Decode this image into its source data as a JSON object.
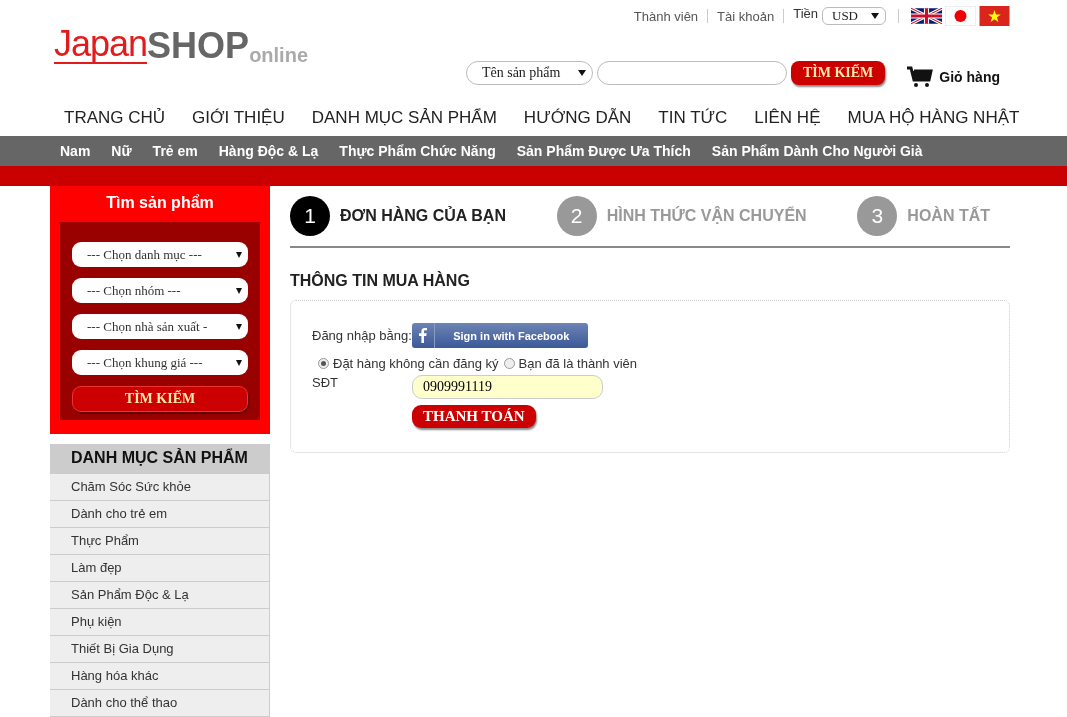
{
  "top_bar": {
    "links": [
      "Thành viên",
      "Tài khoản"
    ],
    "currency": {
      "label": "Tiền",
      "value": "USD"
    }
  },
  "logo": {
    "part_1": "Japan",
    "part_2": "SHOP",
    "part_3": "online"
  },
  "search": {
    "category": "Tên sản phẩm",
    "button": "TÌM KIẾM"
  },
  "cart": {
    "label": "Giỏ hàng"
  },
  "main_menu": [
    "TRANG CHỦ",
    "GIỚI THIỆU",
    "DANH MỤC SẢN PHẨM",
    "HƯỚNG DẪN",
    "TIN TỨC",
    "LIÊN HỆ",
    "MUA HỘ HÀNG NHẬT"
  ],
  "sub_menu": [
    "Nam",
    "Nữ",
    "Trẻ em",
    "Hàng Độc & Lạ",
    "Thực Phẩm Chức Năng",
    "Sản Phẩm Được Ưa Thích",
    "Sản Phẩm Dành Cho Người Già"
  ],
  "sidebar": {
    "search_box": {
      "title": "Tìm sản phẩm",
      "selects": [
        "--- Chọn danh mục ---",
        "--- Chọn nhóm ---",
        "--- Chọn nhà sản xuất -",
        "--- Chọn khung giá ---"
      ],
      "button": "TÌM KIẾM"
    },
    "categories": {
      "title": "DANH MỤC SẢN PHẨM",
      "items": [
        "Chăm Sóc Sức khỏe",
        "Dành cho trẻ em",
        "Thực Phẩm",
        "Làm đẹp",
        "Sản Phẩm Độc & Lạ",
        "Phụ kiện",
        "Thiết Bị Gia Dụng",
        "Hàng hóa khác",
        "Dành cho thể thao"
      ]
    }
  },
  "checkout": {
    "steps": [
      {
        "number": "1",
        "label": "ĐƠN HÀNG CỦA BẠN",
        "selected": true
      },
      {
        "number": "2",
        "label": "HÌNH THỨC VẬN CHUYỂN",
        "selected": false
      },
      {
        "number": "3",
        "label": "HOÀN TẤT",
        "selected": false
      }
    ],
    "section_title": "THÔNG TIN MUA HÀNG",
    "login_label": "Đăng nhập bằng:",
    "facebook_button": "Sign in with Facebook",
    "options": [
      {
        "label": "Đặt hàng không cần đăng ký",
        "selected": true
      },
      {
        "label": "Bạn đã là thành viên",
        "selected": false
      }
    ],
    "phone": {
      "label": "SĐT",
      "value": "0909991119"
    },
    "submit": "THANH TOÁN"
  }
}
